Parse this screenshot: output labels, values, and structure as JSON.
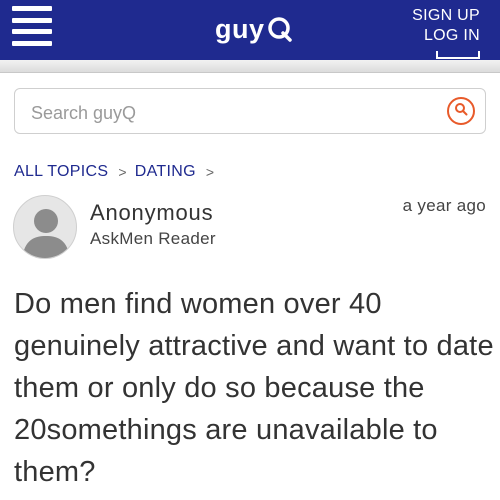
{
  "header": {
    "logo_text": "guy",
    "logo_letter": "Q",
    "sign_up": "SIGN UP",
    "log_in": "LOG IN",
    "brand_color": "#1f2a8f",
    "icons": {
      "menu": "hamburger-icon"
    }
  },
  "search": {
    "placeholder": "Search guyQ",
    "value": "",
    "accent": "#e85a2a",
    "icon": "search-icon"
  },
  "breadcrumb": {
    "items": [
      "ALL TOPICS",
      "DATING"
    ],
    "separator": ">"
  },
  "post": {
    "author": "Anonymous",
    "role": "AskMen Reader",
    "timestamp": "a year ago",
    "avatar_icon": "user-silhouette-icon",
    "question": "Do men find women over 40 genuinely attractive and want to date them or only do so because the 20somethings are unavailable to them?"
  }
}
